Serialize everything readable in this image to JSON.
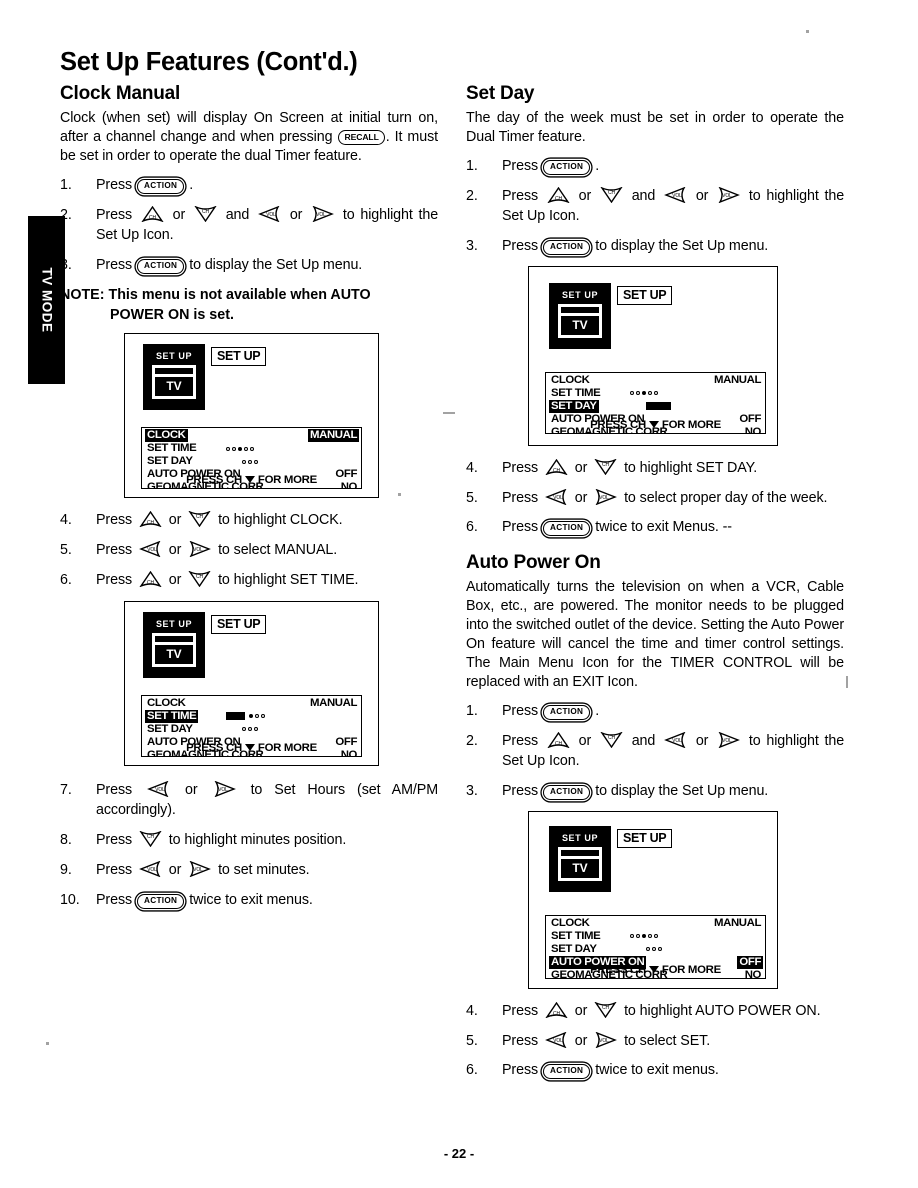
{
  "page": {
    "number_label": "- 22 -",
    "side_tab": "TV MODE",
    "title": "Set Up Features (Cont'd.)"
  },
  "icons": {
    "action_button": "ACTION",
    "recall_button": "RECALL",
    "ch_up": "CH",
    "ch_down": "CH",
    "vol_left": "VOL",
    "vol_right": "VOL",
    "down_triangle": "chevron-down-icon"
  },
  "left_column": {
    "section_title": "Clock Manual",
    "intro_part1": "Clock (when set) will display On Screen at initial turn on, after a channel change and when pressing",
    "intro_part2": ". It must be set in order to operate the dual Timer feature.",
    "steps_a": [
      {
        "num": "1.",
        "pre": "Press",
        "post": "."
      },
      {
        "num": "2.",
        "pre": "Press",
        "mid1": "or",
        "mid2": "and",
        "mid3": "or",
        "post": "to highlight the Set Up Icon."
      },
      {
        "num": "3.",
        "pre": "Press",
        "post": "to display the Set Up menu."
      }
    ],
    "note_label": "NOTE:",
    "note_text": "This menu is not available when AUTO",
    "note_text2": "POWER ON is set.",
    "steps_b": [
      {
        "num": "4.",
        "pre": "Press",
        "mid": "or",
        "post": "to highlight CLOCK."
      },
      {
        "num": "5.",
        "pre": "Press",
        "mid": "or",
        "post": "to select MANUAL."
      },
      {
        "num": "6.",
        "pre": "Press",
        "mid": "or",
        "post": "to highlight SET TIME."
      }
    ],
    "steps_c": [
      {
        "num": "7.",
        "pre": "Press",
        "mid": "or",
        "post": "to Set Hours (set AM/PM accordingly)."
      },
      {
        "num": "8.",
        "pre": "Press",
        "post": "to highlight minutes position."
      },
      {
        "num": "9.",
        "pre": "Press",
        "mid": "or",
        "post": "to set minutes."
      },
      {
        "num": "10.",
        "pre": "Press",
        "post": "twice to exit menus."
      }
    ]
  },
  "right_column": {
    "set_day": {
      "section_title": "Set Day",
      "intro": "The day of the week must be set in order to operate the Dual Timer feature.",
      "steps_a": [
        {
          "num": "1.",
          "pre": "Press",
          "post": "."
        },
        {
          "num": "2.",
          "pre": "Press",
          "mid1": "or",
          "mid2": "and",
          "mid3": "or",
          "post": "to highlight the Set Up Icon."
        },
        {
          "num": "3.",
          "pre": "Press",
          "post": "to display the Set Up menu."
        }
      ],
      "steps_b": [
        {
          "num": "4.",
          "pre": "Press",
          "mid": "or",
          "post": "to highlight SET DAY."
        },
        {
          "num": "5.",
          "pre": "Press",
          "mid": "or",
          "post": "to select proper day of the week."
        },
        {
          "num": "6.",
          "pre": "Press",
          "post": "twice to exit Menus.  --"
        }
      ]
    },
    "auto_power_on": {
      "section_title": "Auto Power On",
      "intro": "Automatically turns the television on when a VCR, Cable Box, etc., are powered. The monitor needs to be plugged into the switched outlet of the device. Setting the Auto Power On feature will cancel the time and timer control settings. The Main Menu Icon for the TIMER CONTROL will be replaced with an EXIT Icon.",
      "steps_a": [
        {
          "num": "1.",
          "pre": "Press",
          "post": "."
        },
        {
          "num": "2.",
          "pre": "Press",
          "mid1": "or",
          "mid2": "and",
          "mid3": "or",
          "post": "to highlight the Set Up Icon."
        },
        {
          "num": "3.",
          "pre": "Press",
          "post": "to display the Set Up menu."
        }
      ],
      "steps_b": [
        {
          "num": "4.",
          "pre": "Press",
          "mid": "or",
          "post": "to highlight AUTO POWER ON."
        },
        {
          "num": "5.",
          "pre": "Press",
          "mid": "or",
          "post": "to select SET."
        },
        {
          "num": "6.",
          "pre": "Press",
          "post": "twice to exit menus."
        }
      ]
    }
  },
  "osd": {
    "icon_label": "SET UP",
    "icon_tv_text": "TV",
    "tag_label": "SET UP",
    "footer": "PRESS CH",
    "footer2": "FOR MORE",
    "rows": {
      "clock": "CLOCK",
      "clock_value": "MANUAL",
      "set_time": "SET TIME",
      "set_day": "SET DAY",
      "auto_power_on": "AUTO POWER ON",
      "auto_power_on_value": "OFF",
      "geomagnetic": "GEOMAGNETIC CORR",
      "geomagnetic_value": "NO"
    },
    "screens": [
      {
        "name": "clock-highlighted",
        "highlight": "clock"
      },
      {
        "name": "set-time-highlighted",
        "highlight": "set_time"
      },
      {
        "name": "set-day-highlighted",
        "highlight": "set_day"
      },
      {
        "name": "auto-power-on-highlighted",
        "highlight": "auto_power_on"
      }
    ]
  }
}
